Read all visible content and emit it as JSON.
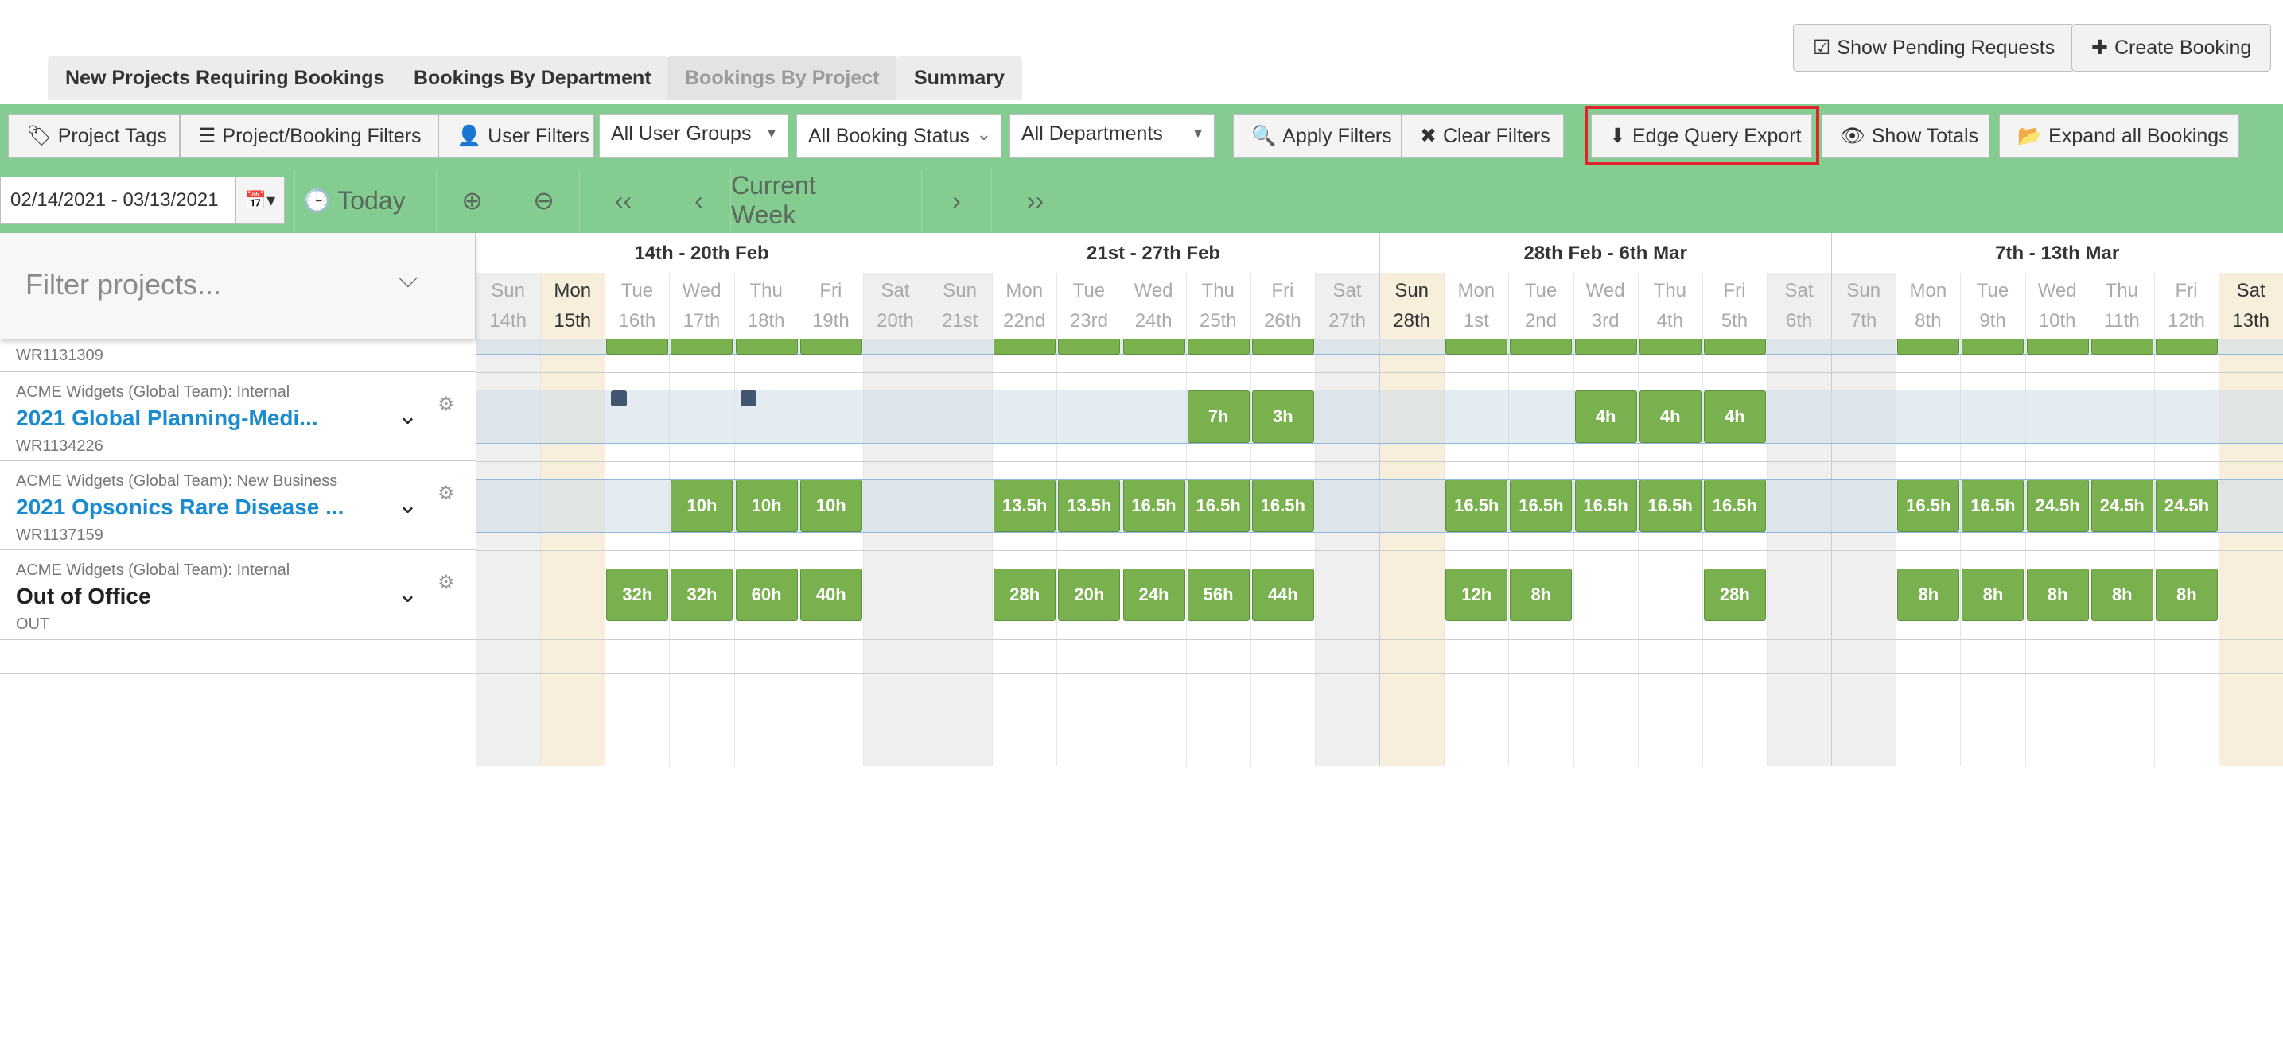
{
  "tabs": [
    "New Projects Requiring Bookings",
    "Bookings By Department",
    "Bookings By Project",
    "Summary"
  ],
  "top_buttons": {
    "pending": "Show Pending Requests",
    "create": "Create Booking"
  },
  "filters": {
    "project_tags": "Project Tags",
    "project_booking_filters": "Project/Booking Filters",
    "user_filters": "User Filters",
    "user_groups": "All User Groups",
    "booking_status": "All Booking Status",
    "departments": "All Departments",
    "apply": "Apply Filters",
    "clear": "Clear Filters",
    "export": "Edge Query Export",
    "show_totals": "Show Totals",
    "expand_all": "Expand all Bookings"
  },
  "nav": {
    "date_range": "02/14/2021 - 03/13/2021",
    "today": "Today",
    "current_week": "Current Week"
  },
  "filter_projects": {
    "placeholder": "Filter projects..."
  },
  "weeks": [
    "14th - 20th Feb",
    "21st - 27th Feb",
    "28th Feb - 6th Mar",
    "7th - 13th Mar"
  ],
  "days": [
    {
      "dow": "Sun",
      "date": "14th"
    },
    {
      "dow": "Mon",
      "date": "15th"
    },
    {
      "dow": "Tue",
      "date": "16th"
    },
    {
      "dow": "Wed",
      "date": "17th"
    },
    {
      "dow": "Thu",
      "date": "18th"
    },
    {
      "dow": "Fri",
      "date": "19th"
    },
    {
      "dow": "Sat",
      "date": "20th"
    },
    {
      "dow": "Sun",
      "date": "21st"
    },
    {
      "dow": "Mon",
      "date": "22nd"
    },
    {
      "dow": "Tue",
      "date": "23rd"
    },
    {
      "dow": "Wed",
      "date": "24th"
    },
    {
      "dow": "Thu",
      "date": "25th"
    },
    {
      "dow": "Fri",
      "date": "26th"
    },
    {
      "dow": "Sat",
      "date": "27th"
    },
    {
      "dow": "Sun",
      "date": "28th"
    },
    {
      "dow": "Mon",
      "date": "1st"
    },
    {
      "dow": "Tue",
      "date": "2nd"
    },
    {
      "dow": "Wed",
      "date": "3rd"
    },
    {
      "dow": "Thu",
      "date": "4th"
    },
    {
      "dow": "Fri",
      "date": "5th"
    },
    {
      "dow": "Sat",
      "date": "6th"
    },
    {
      "dow": "Sun",
      "date": "7th"
    },
    {
      "dow": "Mon",
      "date": "8th"
    },
    {
      "dow": "Tue",
      "date": "9th"
    },
    {
      "dow": "Wed",
      "date": "10th"
    },
    {
      "dow": "Thu",
      "date": "11th"
    },
    {
      "dow": "Fri",
      "date": "12th"
    },
    {
      "dow": "Sat",
      "date": "13th"
    }
  ],
  "rows": [
    {
      "code": "WR1131309"
    },
    {
      "client": "ACME Widgets (Global Team): Internal",
      "name": "2021 Global Planning-Medi...",
      "code": "WR1134226"
    },
    {
      "client": "ACME Widgets (Global Team): New Business",
      "name": "2021 Opsonics Rare Disease ...",
      "code": "WR1137159"
    },
    {
      "client": "ACME Widgets (Global Team): Internal",
      "name": "Out of Office",
      "code": "OUT"
    }
  ],
  "bookings": {
    "row2": [
      {
        "day": 11,
        "label": "7h"
      },
      {
        "day": 12,
        "label": "3h"
      },
      {
        "day": 17,
        "label": "4h"
      },
      {
        "day": 18,
        "label": "4h"
      },
      {
        "day": 19,
        "label": "4h"
      }
    ],
    "row3": [
      {
        "day": 3,
        "label": "10h"
      },
      {
        "day": 4,
        "label": "10h"
      },
      {
        "day": 5,
        "label": "10h"
      },
      {
        "day": 8,
        "label": "13.5h"
      },
      {
        "day": 9,
        "label": "13.5h"
      },
      {
        "day": 10,
        "label": "16.5h"
      },
      {
        "day": 11,
        "label": "16.5h"
      },
      {
        "day": 12,
        "label": "16.5h"
      },
      {
        "day": 15,
        "label": "16.5h"
      },
      {
        "day": 16,
        "label": "16.5h"
      },
      {
        "day": 17,
        "label": "16.5h"
      },
      {
        "day": 18,
        "label": "16.5h"
      },
      {
        "day": 19,
        "label": "16.5h"
      },
      {
        "day": 22,
        "label": "16.5h"
      },
      {
        "day": 23,
        "label": "16.5h"
      },
      {
        "day": 24,
        "label": "24.5h"
      },
      {
        "day": 25,
        "label": "24.5h"
      },
      {
        "day": 26,
        "label": "24.5h"
      }
    ],
    "row4": [
      {
        "day": 2,
        "label": "32h"
      },
      {
        "day": 3,
        "label": "32h"
      },
      {
        "day": 4,
        "label": "60h"
      },
      {
        "day": 5,
        "label": "40h"
      },
      {
        "day": 8,
        "label": "28h"
      },
      {
        "day": 9,
        "label": "20h"
      },
      {
        "day": 10,
        "label": "24h"
      },
      {
        "day": 11,
        "label": "56h"
      },
      {
        "day": 12,
        "label": "44h"
      },
      {
        "day": 15,
        "label": "12h"
      },
      {
        "day": 16,
        "label": "8h"
      },
      {
        "day": 19,
        "label": "28h"
      },
      {
        "day": 22,
        "label": "8h"
      },
      {
        "day": 23,
        "label": "8h"
      },
      {
        "day": 24,
        "label": "8h"
      },
      {
        "day": 25,
        "label": "8h"
      },
      {
        "day": 26,
        "label": "8h"
      }
    ]
  }
}
